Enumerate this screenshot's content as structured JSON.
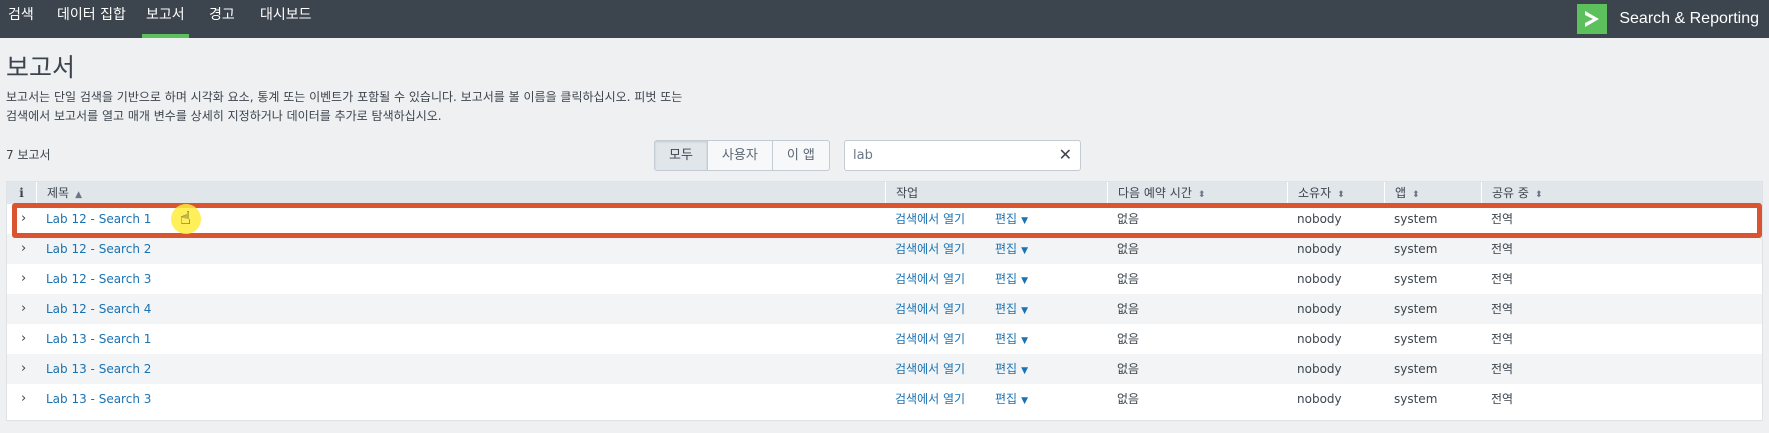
{
  "nav": {
    "items": [
      "검색",
      "데이터 집합",
      "보고서",
      "경고",
      "대시보드"
    ],
    "active_index": 2,
    "brand": "Search & Reporting",
    "brand_color": "#5cc05c"
  },
  "page": {
    "title": "보고서",
    "description": "보고서는 단일 검색을 기반으로 하며 시각화 요소, 통계 또는 이벤트가 포함될 수 있습니다. 보고서를 볼 이름을 클릭하십시오. 피벗 또는 검색에서 보고서를 열고 매개 변수를 상세히 지정하거나 데이터를 추가로 탐색하십시오.",
    "count_label": "7 보고서"
  },
  "filter": {
    "options": [
      "모두",
      "사용자",
      "이 앱"
    ],
    "active_index": 0
  },
  "search": {
    "value": "lab",
    "clear_icon": "close-icon"
  },
  "table": {
    "columns": {
      "info": "i",
      "title": "제목",
      "actions": "작업",
      "next_scheduled": "다음 예약 시간",
      "owner": "소유자",
      "app": "앱",
      "sharing": "공유 중"
    },
    "open_label": "검색에서 열기",
    "edit_label": "편집",
    "rows": [
      {
        "title": "Lab 12 - Search 1",
        "next": "없음",
        "owner": "nobody",
        "app": "system",
        "sharing": "전역"
      },
      {
        "title": "Lab 12 - Search 2",
        "next": "없음",
        "owner": "nobody",
        "app": "system",
        "sharing": "전역"
      },
      {
        "title": "Lab 12 - Search 3",
        "next": "없음",
        "owner": "nobody",
        "app": "system",
        "sharing": "전역"
      },
      {
        "title": "Lab 12 - Search 4",
        "next": "없음",
        "owner": "nobody",
        "app": "system",
        "sharing": "전역"
      },
      {
        "title": "Lab 13 - Search 1",
        "next": "없음",
        "owner": "nobody",
        "app": "system",
        "sharing": "전역"
      },
      {
        "title": "Lab 13 - Search 2",
        "next": "없음",
        "owner": "nobody",
        "app": "system",
        "sharing": "전역"
      },
      {
        "title": "Lab 13 - Search 3",
        "next": "없음",
        "owner": "nobody",
        "app": "system",
        "sharing": "전역"
      }
    ],
    "highlighted_row": 0,
    "highlight_color": "#d9542f"
  }
}
